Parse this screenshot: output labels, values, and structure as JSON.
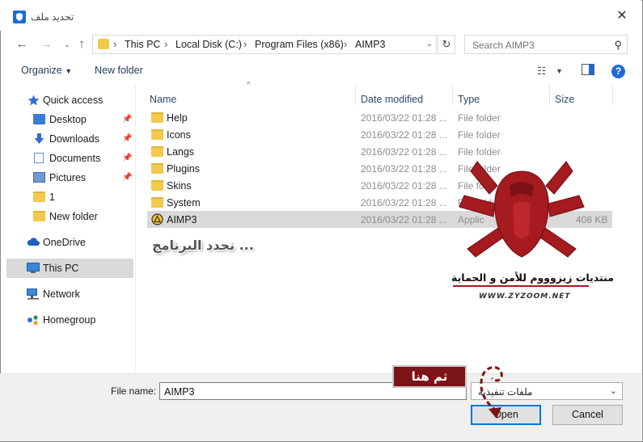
{
  "window": {
    "title": "تحديد ملف"
  },
  "breadcrumb": [
    "This PC",
    "Local Disk (C:)",
    "Program Files (x86)",
    "AIMP3"
  ],
  "search": {
    "placeholder": "Search AIMP3"
  },
  "toolbar": {
    "organize_label": "Organize",
    "new_folder_label": "New folder"
  },
  "sidebar": {
    "items": [
      {
        "label": "Quick access",
        "icon": "star-icon"
      },
      {
        "label": "Desktop",
        "icon": "desktop-icon",
        "pinned": true
      },
      {
        "label": "Downloads",
        "icon": "download-icon",
        "pinned": true
      },
      {
        "label": "Documents",
        "icon": "document-icon",
        "pinned": true
      },
      {
        "label": "Pictures",
        "icon": "pictures-icon",
        "pinned": true
      },
      {
        "label": "1",
        "icon": "folder-icon"
      },
      {
        "label": "New folder",
        "icon": "folder-icon"
      },
      {
        "label": "OneDrive",
        "icon": "cloud-icon"
      },
      {
        "label": "This PC",
        "icon": "computer-icon",
        "selected": true
      },
      {
        "label": "Network",
        "icon": "network-icon"
      },
      {
        "label": "Homegroup",
        "icon": "homegroup-icon"
      }
    ]
  },
  "columns": {
    "name": "Name",
    "date": "Date modified",
    "type": "Type",
    "size": "Size"
  },
  "files": [
    {
      "name": "Help",
      "date": "2016/03/22 01:28 ...",
      "type": "File folder",
      "size": "",
      "icon": "folder-icon"
    },
    {
      "name": "Icons",
      "date": "2016/03/22 01:28 ...",
      "type": "File folder",
      "size": "",
      "icon": "folder-icon"
    },
    {
      "name": "Langs",
      "date": "2016/03/22 01:28 ...",
      "type": "File folder",
      "size": "",
      "icon": "folder-icon"
    },
    {
      "name": "Plugins",
      "date": "2016/03/22 01:28 ...",
      "type": "File folder",
      "size": "",
      "icon": "folder-icon"
    },
    {
      "name": "Skins",
      "date": "2016/03/22 01:28 ...",
      "type": "File fo",
      "size": "",
      "icon": "folder-icon"
    },
    {
      "name": "System",
      "date": "2016/03/22 01:28 ...",
      "type": "File folder",
      "size": "",
      "icon": "folder-icon"
    },
    {
      "name": "AIMP3",
      "date": "2016/03/22 01:28 ...",
      "type": "Applic",
      "size": "408 KB",
      "icon": "aimp-icon",
      "selected": true
    }
  ],
  "bottom": {
    "filename_label": "File name:",
    "filename_value": "AIMP3",
    "filetype_value": "ملفات تنفيذية",
    "open_label": "Open",
    "cancel_label": "Cancel"
  },
  "overlay": {
    "select_program": "نحدد البرنامج ...",
    "forum_name": "منتديات زيزوووم للأمن و الحماية",
    "forum_url": "WWW.ZYZOOM.NET",
    "then_here": "ثم هنا"
  },
  "colors": {
    "accent": "#0078d7",
    "logo_red": "#a51b1f",
    "banner": "#7b1416"
  }
}
